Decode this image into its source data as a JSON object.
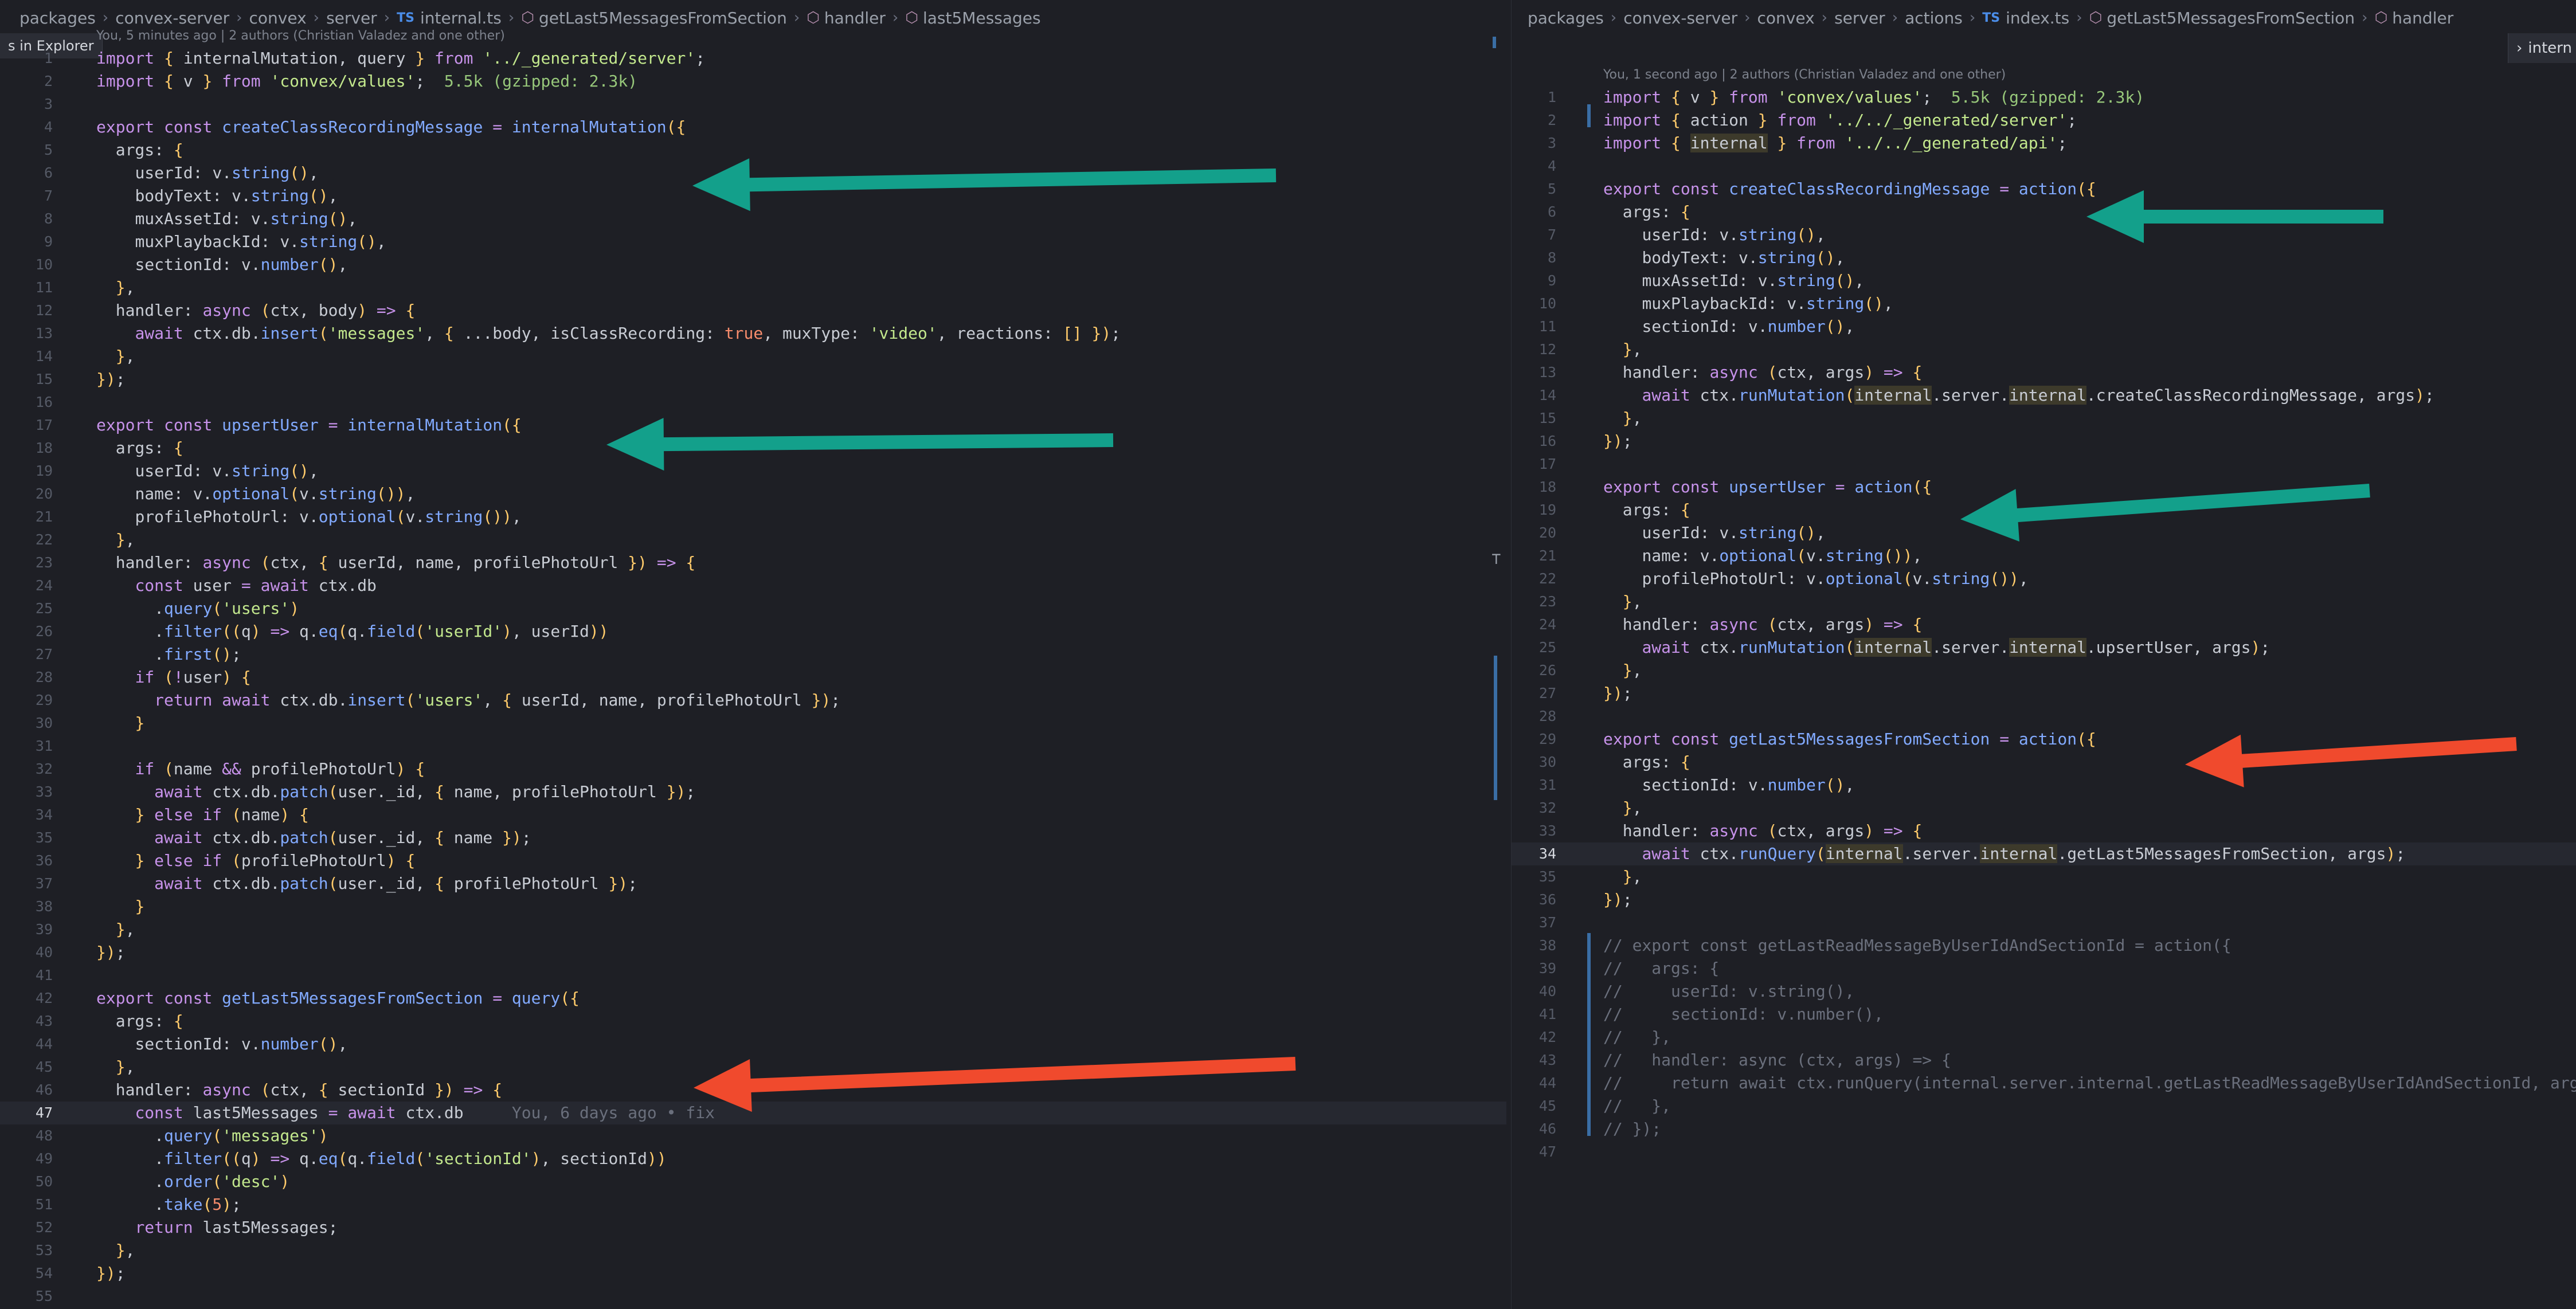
{
  "left": {
    "breadcrumbs": [
      "packages",
      "convex-server",
      "convex",
      "server",
      "internal.ts",
      "getLast5MessagesFromSection",
      "handler",
      "last5Messages"
    ],
    "ts_badge": "TS",
    "file_index": 4,
    "explorer_tag": "s in Explorer",
    "blame_header": "You, 5 minutes ago | 2 authors (Christian Valadez and one other)",
    "inline_blame": "You, 6 days ago • fix",
    "active_line": 47
  },
  "right": {
    "breadcrumbs": [
      "packages",
      "convex-server",
      "convex",
      "server",
      "actions",
      "index.ts",
      "getLast5MessagesFromSection",
      "handler"
    ],
    "ts_badge": "TS",
    "file_index": 5,
    "blame_header": "You, 1 second ago | 2 authors (Christian Valadez and one other)",
    "side_tag": "intern",
    "active_line": 34
  },
  "arrow_colors": {
    "teal": "#13a08b",
    "red": "#f04a2d"
  },
  "icons": [
    "chevron-right-icon",
    "ts-file-icon",
    "symbol-method-icon",
    "split-editor-icon"
  ],
  "left_code": [
    "import { internalMutation, query } from '../_generated/server';",
    "import { v } from 'convex/values';  5.5k (gzipped: 2.3k)",
    "",
    "export const createClassRecordingMessage = internalMutation({",
    "  args: {",
    "    userId: v.string(),",
    "    bodyText: v.string(),",
    "    muxAssetId: v.string(),",
    "    muxPlaybackId: v.string(),",
    "    sectionId: v.number(),",
    "  },",
    "  handler: async (ctx, body) => {",
    "    await ctx.db.insert('messages', { ...body, isClassRecording: true, muxType: 'video', reactions: [] });",
    "  },",
    "});",
    "",
    "export const upsertUser = internalMutation({",
    "  args: {",
    "    userId: v.string(),",
    "    name: v.optional(v.string()),",
    "    profilePhotoUrl: v.optional(v.string()),",
    "  },",
    "  handler: async (ctx, { userId, name, profilePhotoUrl }) => {",
    "    const user = await ctx.db",
    "      .query('users')",
    "      .filter((q) => q.eq(q.field('userId'), userId))",
    "      .first();",
    "    if (!user) {",
    "      return await ctx.db.insert('users', { userId, name, profilePhotoUrl });",
    "    }",
    "",
    "    if (name && profilePhotoUrl) {",
    "      await ctx.db.patch(user._id, { name, profilePhotoUrl });",
    "    } else if (name) {",
    "      await ctx.db.patch(user._id, { name });",
    "    } else if (profilePhotoUrl) {",
    "      await ctx.db.patch(user._id, { profilePhotoUrl });",
    "    }",
    "  },",
    "});",
    "",
    "export const getLast5MessagesFromSection = query({",
    "  args: {",
    "    sectionId: v.number(),",
    "  },",
    "  handler: async (ctx, { sectionId }) => {",
    "    const last5Messages = await ctx.db",
    "      .query('messages')",
    "      .filter((q) => q.eq(q.field('sectionId'), sectionId))",
    "      .order('desc')",
    "      .take(5);",
    "    return last5Messages;",
    "  },",
    "});",
    ""
  ],
  "right_code": [
    "import { v } from 'convex/values';  5.5k (gzipped: 2.3k)",
    "import { action } from '../../_generated/server';",
    "import { internal } from '../../_generated/api';",
    "",
    "export const createClassRecordingMessage = action({",
    "  args: {",
    "    userId: v.string(),",
    "    bodyText: v.string(),",
    "    muxAssetId: v.string(),",
    "    muxPlaybackId: v.string(),",
    "    sectionId: v.number(),",
    "  },",
    "  handler: async (ctx, args) => {",
    "    await ctx.runMutation(internal.server.internal.createClassRecordingMessage, args);",
    "  },",
    "});",
    "",
    "export const upsertUser = action({",
    "  args: {",
    "    userId: v.string(),",
    "    name: v.optional(v.string()),",
    "    profilePhotoUrl: v.optional(v.string()),",
    "  },",
    "  handler: async (ctx, args) => {",
    "    await ctx.runMutation(internal.server.internal.upsertUser, args);",
    "  },",
    "});",
    "",
    "export const getLast5MessagesFromSection = action({",
    "  args: {",
    "    sectionId: v.number(),",
    "  },",
    "  handler: async (ctx, args) => {",
    "    await ctx.runQuery(internal.server.internal.getLast5MessagesFromSection, args);",
    "  },",
    "});",
    "",
    "// export const getLastReadMessageByUserIdAndSectionId = action({",
    "//   args: {",
    "//     userId: v.string(),",
    "//     sectionId: v.number(),",
    "//   },",
    "//   handler: async (ctx, args) => {",
    "//     return await ctx.runQuery(internal.server.internal.getLastReadMessageByUserIdAndSectionId, args);",
    "//   },",
    "// });",
    ""
  ]
}
